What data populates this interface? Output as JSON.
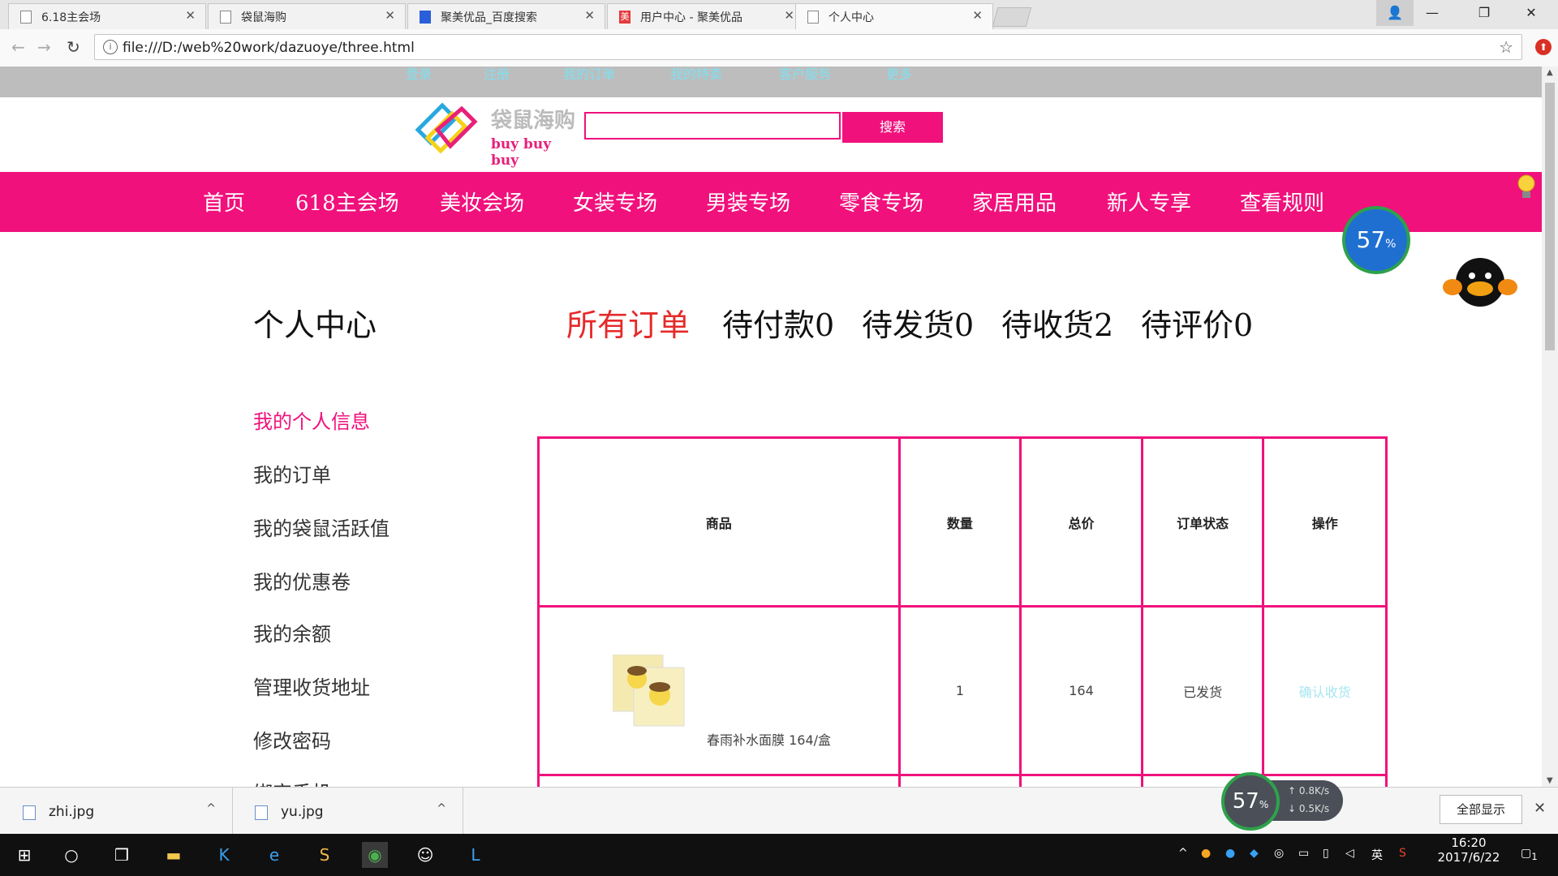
{
  "browser": {
    "tabs": [
      {
        "title": "6.18主会场",
        "icon": "page-icon"
      },
      {
        "title": "袋鼠海购",
        "icon": "page-icon"
      },
      {
        "title": "聚美优品_百度搜索",
        "icon": "baidu-paw-icon"
      },
      {
        "title": "用户中心 - 聚美优品",
        "icon": "jumei-icon",
        "icon_text": "美"
      },
      {
        "title": "个人中心",
        "icon": "page-icon"
      }
    ],
    "url": "file:///D:/web%20work/dazuoye/three.html"
  },
  "topbar": {
    "links": [
      "登录",
      "注册",
      "我的订单",
      "我的特卖",
      "客户服务",
      "更多"
    ]
  },
  "header": {
    "logo_cn": "袋鼠海购",
    "logo_en": "buy buy buy",
    "search_value": "",
    "search_button": "搜索"
  },
  "mainnav": {
    "items": [
      "首页",
      "618主会场",
      "美妆会场",
      "女装专场",
      "男装专场",
      "零食专场",
      "家居用品",
      "新人专享",
      "查看规则"
    ]
  },
  "content": {
    "page_title": "个人中心",
    "order_tabs": [
      "所有订单",
      "待付款0",
      "待发货0",
      "待收货2",
      "待评价0"
    ],
    "sidebar": [
      "我的个人信息",
      "我的订单",
      "我的袋鼠活跃值",
      "我的优惠卷",
      "我的余额",
      "管理收货地址",
      "修改密码",
      "绑定手机"
    ],
    "table": {
      "headers": [
        "商品",
        "数量",
        "总价",
        "订单状态",
        "操作"
      ],
      "rows": [
        {
          "product": "春雨补水面膜 164/盒",
          "qty": "1",
          "total": "164",
          "status": "已发货",
          "action": "确认收货"
        }
      ]
    }
  },
  "widgets": {
    "speed_percent": "57",
    "speed_unit": "%",
    "net_up": "0.8",
    "net_down": "0.5",
    "net_unit": "K/s"
  },
  "downloads": {
    "items": [
      "zhi.jpg",
      "yu.jpg"
    ],
    "show_all": "全部显示"
  },
  "taskbar": {
    "time": "16:20",
    "date": "2017/6/22",
    "ime": "英",
    "notifications": "1"
  },
  "colors": {
    "accent": "#f0117c",
    "active_tab_text": "#e52a2a",
    "toplink": "#7fe0f0"
  }
}
